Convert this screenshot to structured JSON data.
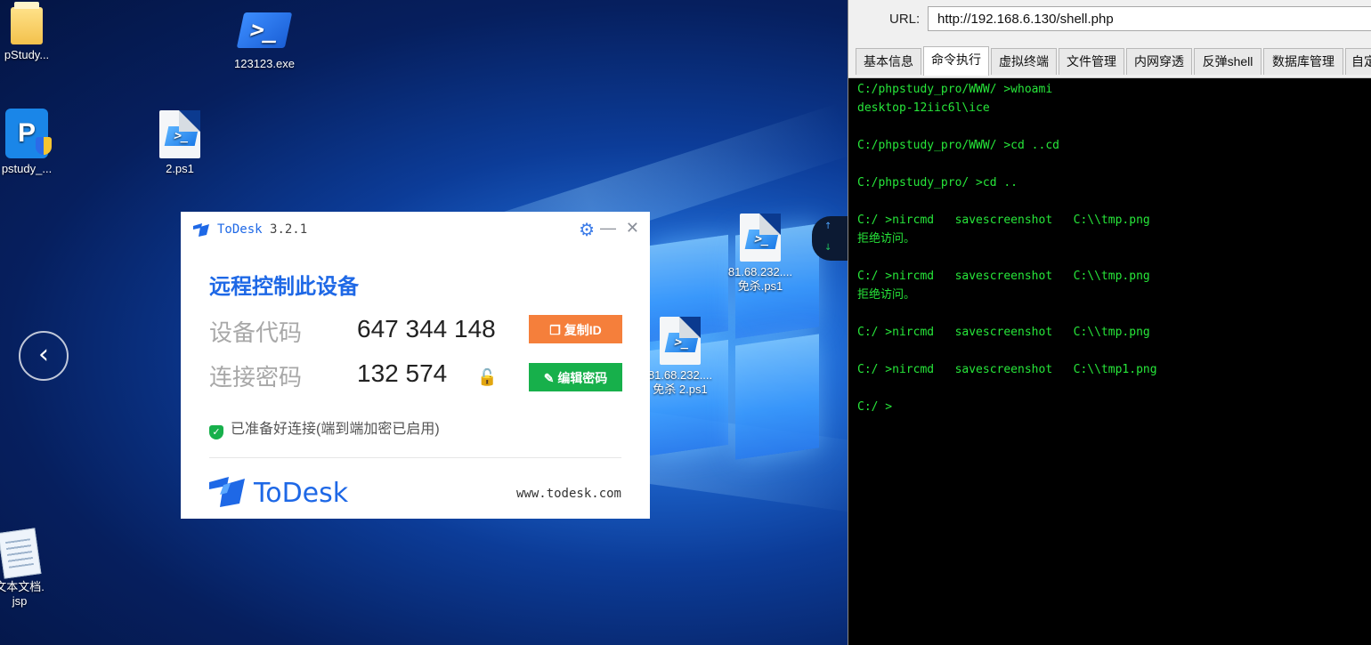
{
  "desktop": {
    "icons": {
      "phpstudy_folder": "pStudy...",
      "powershell_exe": "123123.exe",
      "phpstudy_app": "pstudy_...",
      "ps1_2": "2.ps1",
      "ps1_a_line1": "81.68.232....",
      "ps1_a_line2": "免杀.ps1",
      "ps1_b_line1": "81.68.232....",
      "ps1_b_line2": "免杀 2.ps1",
      "jsp_line1": "文本文档.",
      "jsp_line2": "jsp"
    },
    "nav_back_glyph": "‹"
  },
  "todesk": {
    "app_name": "ToDesk",
    "version": "3.2.1",
    "heading": "远程控制此设备",
    "device_code_label": "设备代码",
    "device_code": "647 344 148",
    "copy_id_button": "复制ID",
    "password_label": "连接密码",
    "password": "132 574",
    "edit_password_button": "编辑密码",
    "status": "已准备好连接(端到端加密已启用)",
    "brand": "ToDesk",
    "website": "www.todesk.com",
    "accent_color": "#1e68e6"
  },
  "shell": {
    "url_label": "URL:",
    "url": "http://192.168.6.130/shell.php",
    "tabs": [
      "基本信息",
      "命令执行",
      "虚拟终端",
      "文件管理",
      "内网穿透",
      "反弹shell",
      "数据库管理",
      "自定"
    ],
    "active_tab": "命令执行",
    "terminal_lines": [
      "C:/phpstudy_pro/WWW/ >whoami",
      "desktop-12iic6l\\ice",
      "",
      "C:/phpstudy_pro/WWW/ >cd ..cd",
      "",
      "C:/phpstudy_pro/ >cd ..",
      "",
      "C:/ >nircmd   savescreenshot   C:\\\\tmp.png",
      "拒绝访问。",
      "",
      "C:/ >nircmd   savescreenshot   C:\\\\tmp.png",
      "拒绝访问。",
      "",
      "C:/ >nircmd   savescreenshot   C:\\\\tmp.png",
      "",
      "C:/ >nircmd   savescreenshot   C:\\\\tmp1.png",
      "",
      "C:/ >"
    ],
    "terminal_color": "#27e63a"
  }
}
